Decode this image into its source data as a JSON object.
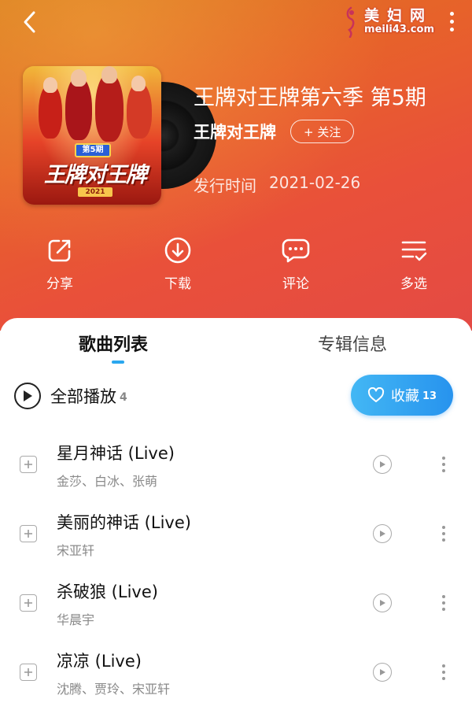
{
  "watermark": {
    "name": "美妇网",
    "domain": "meili43.com"
  },
  "album": {
    "title": "王牌对王牌第六季 第5期",
    "artist": "王牌对王牌",
    "follow_label": "+ 关注",
    "release_label": "发行时间",
    "release_date": "2021-02-26",
    "cover": {
      "badge": "第5期",
      "title": "王牌对王牌",
      "year": "2021"
    }
  },
  "actions": [
    {
      "label": "分享",
      "icon": "share-icon"
    },
    {
      "label": "下载",
      "icon": "download-icon"
    },
    {
      "label": "评论",
      "icon": "comment-icon"
    },
    {
      "label": "多选",
      "icon": "multi-select-icon"
    }
  ],
  "tabs": {
    "songs": "歌曲列表",
    "album_info": "专辑信息",
    "active": "songs"
  },
  "playall": {
    "label": "全部播放",
    "count": "4"
  },
  "collect": {
    "label": "收藏",
    "count": "13"
  },
  "songs": [
    {
      "title": "星月神话 (Live)",
      "artists": "金莎、白冰、张萌"
    },
    {
      "title": "美丽的神话 (Live)",
      "artists": "宋亚轩"
    },
    {
      "title": "杀破狼 (Live)",
      "artists": "华晨宇"
    },
    {
      "title": "凉凉 (Live)",
      "artists": "沈腾、贾玲、宋亚轩"
    }
  ],
  "colors": {
    "accent": "#2aa7ef",
    "hero_start": "#d9781d",
    "hero_end": "#e44a44"
  }
}
